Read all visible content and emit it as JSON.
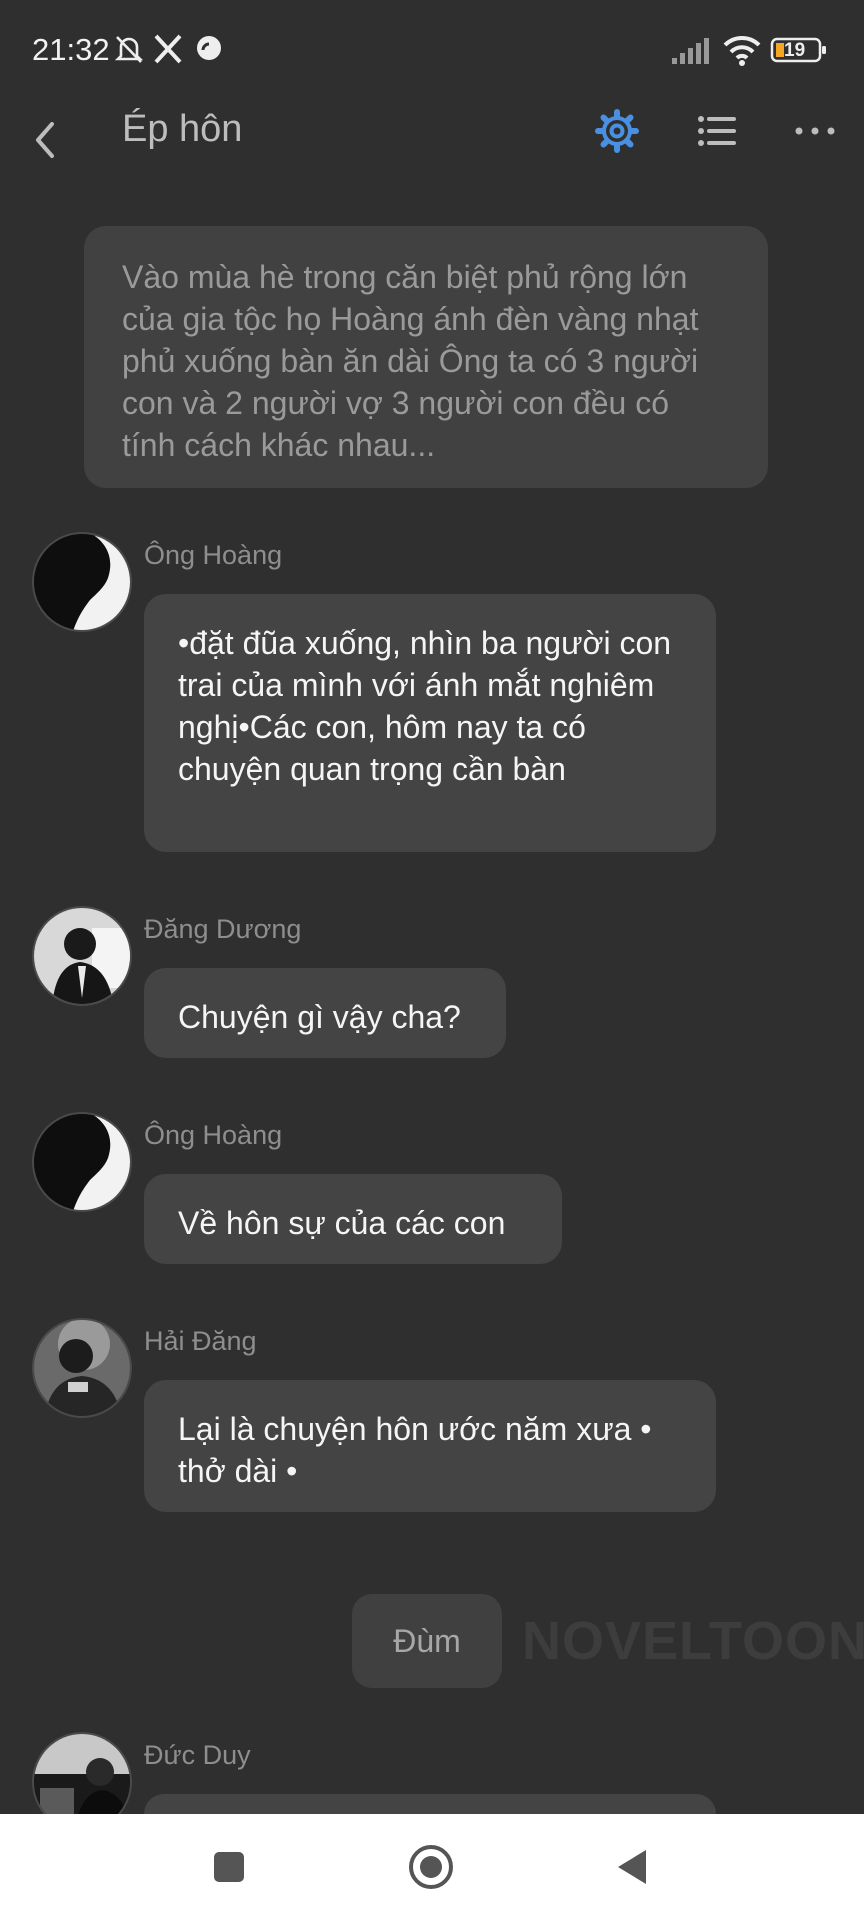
{
  "status": {
    "time": "21:32",
    "battery": "19"
  },
  "header": {
    "title": "Ép hôn"
  },
  "narration": "Vào mùa hè trong căn biệt phủ rộng lớn của gia tộc họ Hoàng ánh đèn vàng nhạt phủ xuống bàn ăn dài Ông ta có 3 người con và 2 người vợ 3 người con đều có tính cách khác nhau...",
  "messages": [
    {
      "sender": "Ông Hoàng",
      "text": "•đặt đũa xuống, nhìn ba người con trai của mình với ánh mắt nghiêm nghị•Các con, hôm nay ta có chuyện quan trọng cần bàn"
    },
    {
      "sender": "Đăng Dương",
      "text": "Chuyện gì vậy cha?"
    },
    {
      "sender": "Ông Hoàng",
      "text": "Về hôn sự của các con"
    },
    {
      "sender": "Hải Đăng",
      "text": "Lại là chuyện hôn ước năm xưa • thở dài •"
    },
    {
      "sender": "Đức Duy",
      "text": ""
    }
  ],
  "system_message": "Đùm",
  "watermark": "NOVELTOON",
  "colors": {
    "accent": "#4a90e2",
    "background": "#2f2f2f",
    "bubble": "#444444"
  }
}
